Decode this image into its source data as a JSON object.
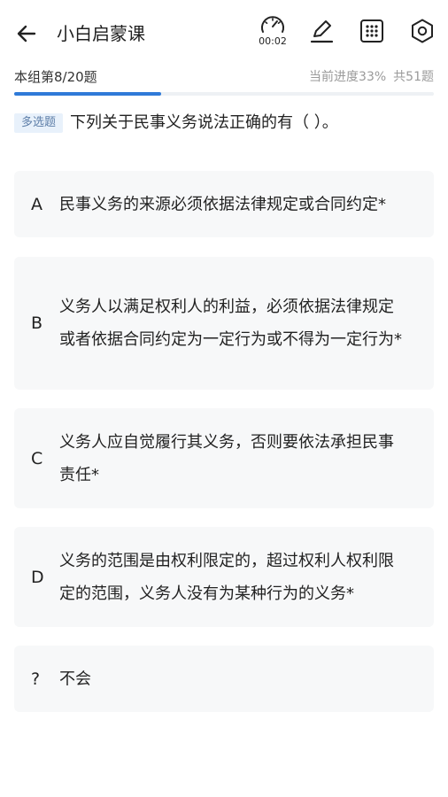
{
  "header": {
    "title": "小白启蒙课",
    "timer": "00:02",
    "icons": [
      "back-arrow-icon",
      "timer-icon",
      "pencil-icon",
      "grid-icon",
      "settings-icon"
    ]
  },
  "progress": {
    "group_label": "本组第8/20题",
    "current": "当前进度33%",
    "total": "共51题",
    "group_fraction": 0.35,
    "accent": "#2f7ad8"
  },
  "question": {
    "type": "多选题",
    "text": "下列关于民事义务说法正确的有（ ）。"
  },
  "options": [
    {
      "letter": "A",
      "text": "民事义务的来源必须依据法律规定或合同约定*"
    },
    {
      "letter": "B",
      "text": "义务人以满足权利人的利益，必须依据法律规定或者依据合同约定为一定行为或不得为一定行为*"
    },
    {
      "letter": "C",
      "text": "义务人应自觉履行其义务，否则要依法承担民事责任*"
    },
    {
      "letter": "D",
      "text": "义务的范围是由权利限定的，超过权利人权利限定的范围，义务人没有为某种行为的义务*"
    },
    {
      "letter": "?",
      "text": "不会"
    }
  ]
}
